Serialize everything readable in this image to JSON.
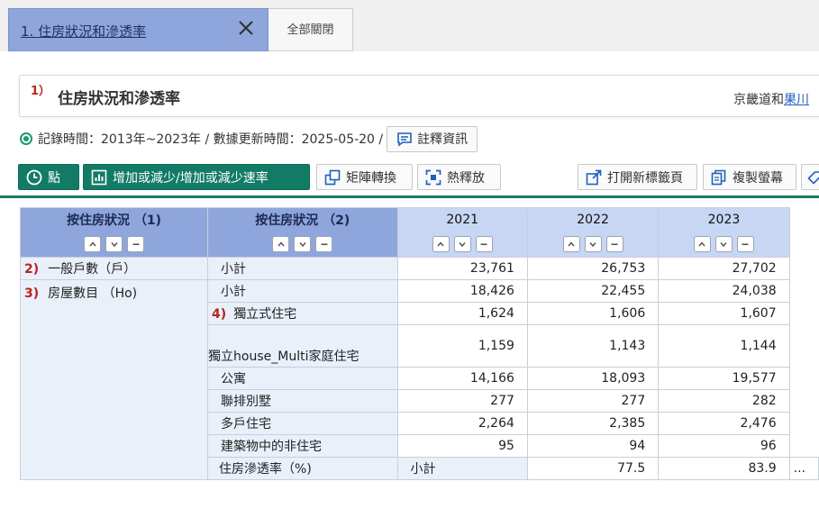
{
  "tabs": {
    "active_title": "1. 住房狀況和滲透率",
    "close_all_label": "全部關閉"
  },
  "header": {
    "number": "1）",
    "title": "住房狀況和滲透率",
    "crumb_text": "京畿道和",
    "crumb_link": "果川"
  },
  "info": {
    "record_time": "記錄時間：2013年~2023年 / 數據更新時間：2025-05-20 /",
    "notes_label": "註釋資訊"
  },
  "toolbar": {
    "point_label": "點",
    "change_label": "增加或減少/增加或減少速率",
    "matrix_label": "矩陣轉換",
    "hotspot_label": "熱釋放",
    "newtab_label": "打開新標籤頁",
    "copy_label": "複製螢幕"
  },
  "table": {
    "row_header_1": "按住房狀況 （1)",
    "row_header_2": "按住房狀況 （2)",
    "years": [
      "2021",
      "2022",
      "2023"
    ],
    "rows": [
      {
        "marker": "2)",
        "c1": "一般戶數（戶）",
        "marker2": "",
        "c2": "小計",
        "v": [
          "23,761",
          "26,753",
          "27,702"
        ]
      },
      {
        "marker": "3)",
        "c1": "房屋數目 （Ho)",
        "marker2": "",
        "c2": "小計",
        "v": [
          "18,426",
          "22,455",
          "24,038"
        ]
      },
      {
        "marker": "",
        "c1": "",
        "marker2": "4)",
        "c2": "獨立式住宅",
        "v": [
          "1,624",
          "1,606",
          "1,607"
        ]
      },
      {
        "marker": "",
        "c1": "",
        "marker2": "",
        "c2": "獨立house_Multi家庭住宅",
        "v": [
          "1,159",
          "1,143",
          "1,144"
        ]
      },
      {
        "marker": "",
        "c1": "",
        "marker2": "",
        "c2": "公寓",
        "v": [
          "14,166",
          "18,093",
          "19,577"
        ]
      },
      {
        "marker": "",
        "c1": "",
        "marker2": "",
        "c2": "聯排別墅",
        "v": [
          "277",
          "277",
          "282"
        ]
      },
      {
        "marker": "",
        "c1": "",
        "marker2": "",
        "c2": "多戶住宅",
        "v": [
          "2,264",
          "2,385",
          "2,476"
        ]
      },
      {
        "marker": "",
        "c1": "",
        "marker2": "",
        "c2": "建築物中的非住宅",
        "v": [
          "95",
          "94",
          "96"
        ]
      },
      {
        "marker": "",
        "c1": "住房滲透率（%)",
        "marker2": "",
        "c2": "小計",
        "v": [
          "77.5",
          "83.9",
          "..."
        ]
      }
    ]
  },
  "colors": {
    "accent_green": "#127b66",
    "header_blue": "#8fa6dc",
    "year_blue": "#c6d6f3",
    "marker_red": "#b8231f"
  }
}
